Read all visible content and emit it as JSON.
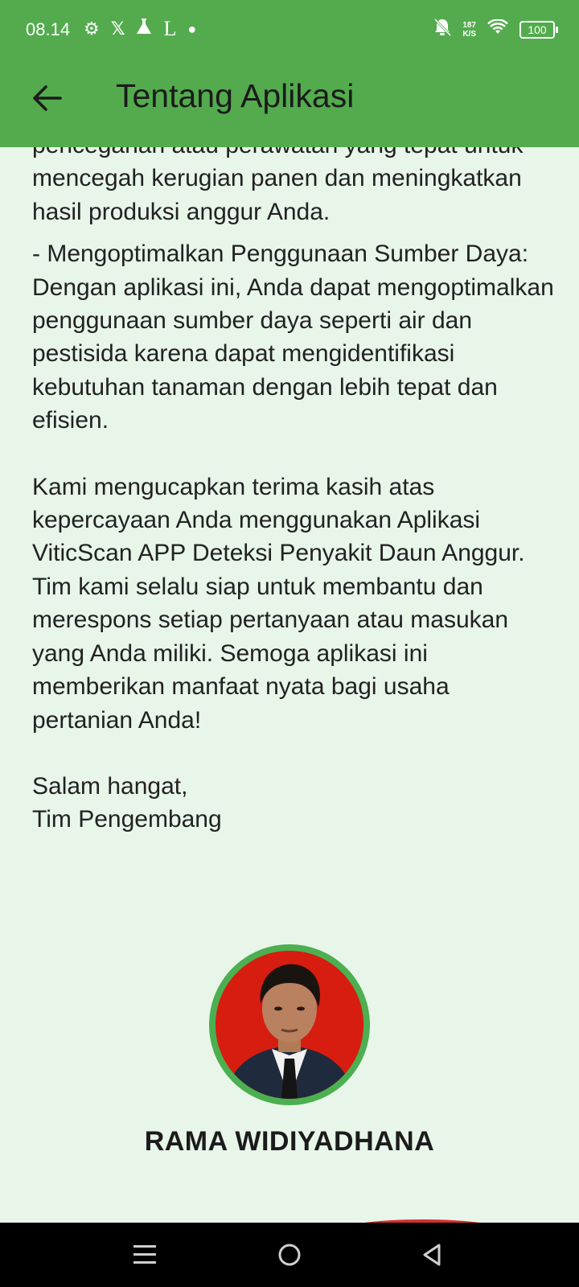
{
  "status_bar": {
    "time": "08.14",
    "icons": [
      "settings-icon",
      "x-icon",
      "flask-icon",
      "l-icon",
      "dot-icon"
    ],
    "speed_value": "187",
    "speed_unit": "K/S",
    "battery": "100"
  },
  "app_bar": {
    "title": "Tentang Aplikasi",
    "back_icon": "arrow-left-icon"
  },
  "content": {
    "paragraphs": [
      "pencegahan atau perawatan yang tepat untuk mencegah kerugian panen dan meningkatkan hasil produksi anggur Anda.",
      "- Mengoptimalkan Penggunaan Sumber Daya: Dengan aplikasi ini, Anda dapat mengoptimalkan penggunaan sumber daya seperti air dan pestisida karena dapat mengidentifikasi kebutuhan tanaman dengan lebih tepat dan efisien.",
      "Kami mengucapkan terima kasih atas kepercayaan Anda menggunakan Aplikasi ViticScan APP Deteksi Penyakit Daun Anggur. Tim kami selalu siap untuk membantu dan merespons setiap pertanyaan atau masukan yang Anda miliki. Semoga aplikasi ini memberikan manfaat nyata bagi usaha pertanian Anda!"
    ],
    "closing_line1": "Salam hangat,",
    "closing_line2": "Tim Pengembang"
  },
  "profile": {
    "name": "RAMA WIDIYADHANA",
    "ring_color": "#4caf50",
    "photo_background": "#d71c10"
  },
  "nav_bar": {
    "icons": [
      "menu-icon",
      "home-icon",
      "back-triangle-icon"
    ]
  },
  "colors": {
    "app_bar": "#53ab4e",
    "page_background": "#e8f5e9",
    "nav_bar": "#000000"
  }
}
